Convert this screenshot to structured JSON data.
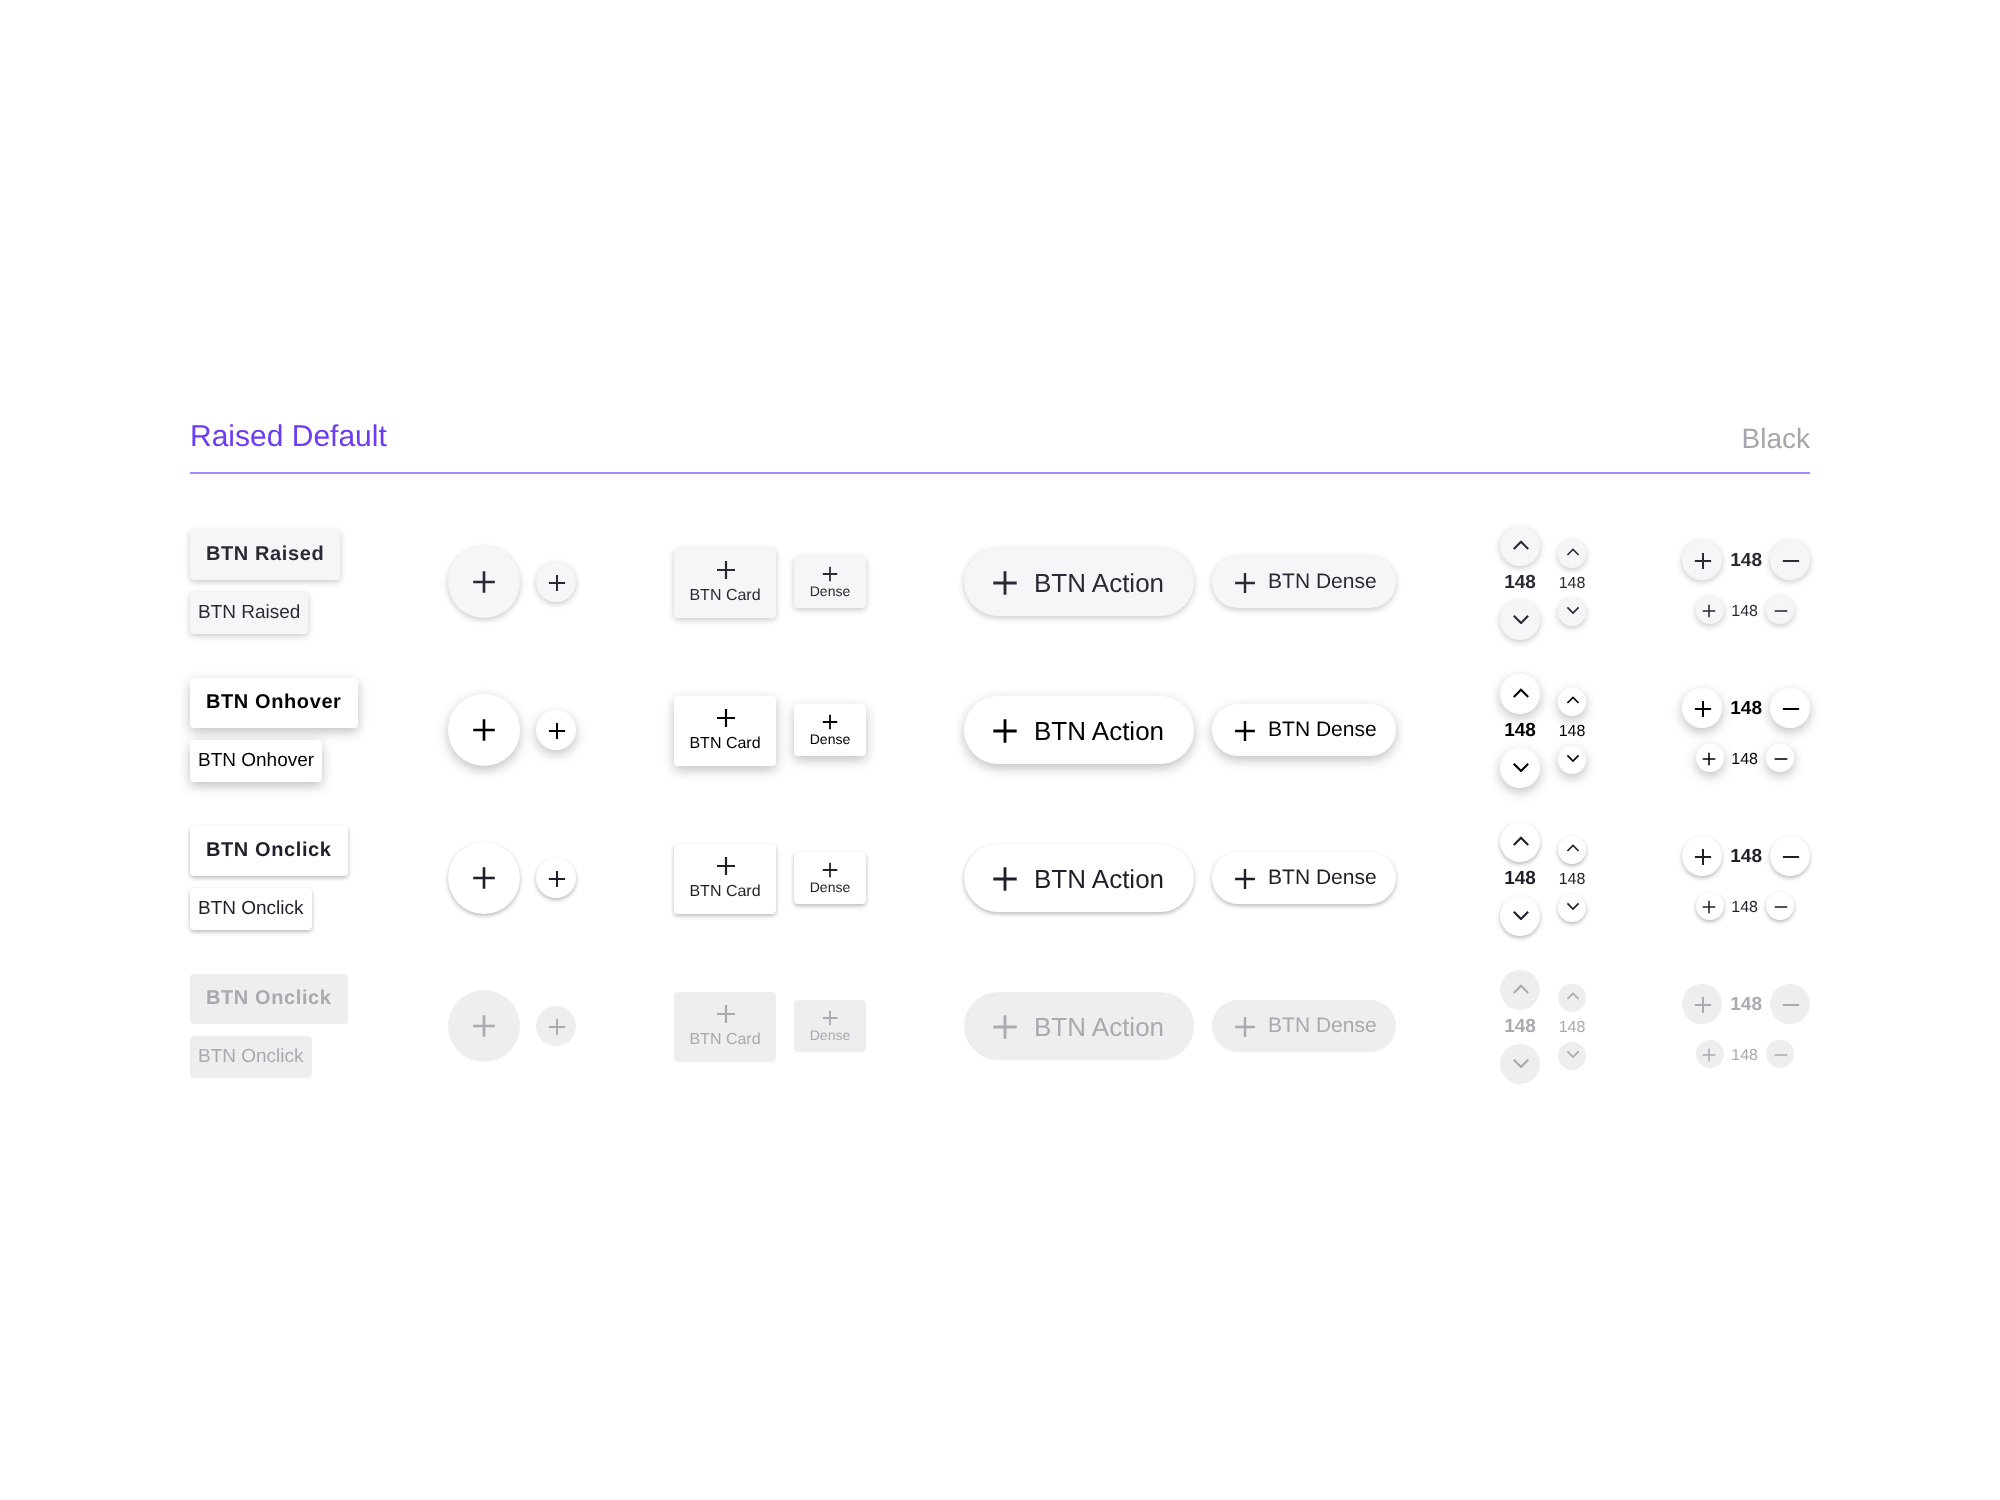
{
  "header": {
    "title": "Raised Default",
    "theme": "Black"
  },
  "rows": [
    {
      "kind": "default",
      "raised": "BTN Raised",
      "raised_small": "BTN Raised",
      "card": "BTN Card",
      "card_dense": "Dense",
      "action": "BTN Action",
      "dense": "BTN Dense",
      "vertical_value": "148",
      "vertical_small_value": "148",
      "horizontal_value": "148",
      "horizontal_small_value": "148"
    },
    {
      "kind": "hover",
      "raised": "BTN Onhover",
      "raised_small": "BTN Onhover",
      "card": "BTN Card",
      "card_dense": "Dense",
      "action": "BTN Action",
      "dense": "BTN Dense",
      "vertical_value": "148",
      "vertical_small_value": "148",
      "horizontal_value": "148",
      "horizontal_small_value": "148"
    },
    {
      "kind": "click",
      "raised": "BTN Onclick",
      "raised_small": "BTN Onclick",
      "card": "BTN Card",
      "card_dense": "Dense",
      "action": "BTN Action",
      "dense": "BTN Dense",
      "vertical_value": "148",
      "vertical_small_value": "148",
      "horizontal_value": "148",
      "horizontal_small_value": "148"
    },
    {
      "kind": "disabled",
      "raised": "BTN Onclick",
      "raised_small": "BTN Onclick",
      "card": "BTN Card",
      "card_dense": "Dense",
      "action": "BTN Action",
      "dense": "BTN Dense",
      "vertical_value": "148",
      "vertical_small_value": "148",
      "horizontal_value": "148",
      "horizontal_small_value": "148"
    }
  ]
}
